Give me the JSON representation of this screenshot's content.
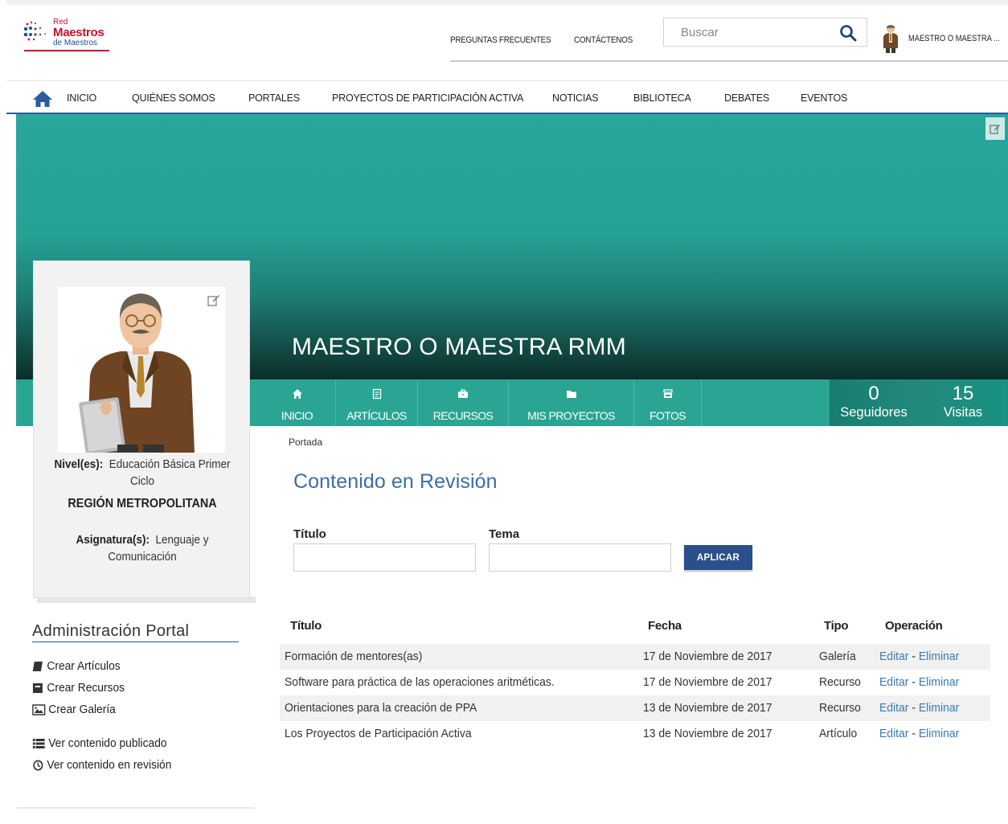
{
  "header": {
    "logo": {
      "line1": "Red",
      "line2": "Maestros",
      "line3": "de Maestros"
    },
    "links": [
      "PREGUNTAS FRECUENTES",
      "CONTÁCTENOS"
    ],
    "search_placeholder": "Buscar",
    "user_name": "MAESTRO O MAESTRA ..."
  },
  "nav": {
    "items": [
      "INICIO",
      "QUIÉNES SOMOS",
      "PORTALES",
      "PROYECTOS DE PARTICIPACIÓN ACTIVA",
      "NOTICIAS",
      "BIBLIOTECA",
      "DEBATES",
      "EVENTOS"
    ]
  },
  "banner": {
    "title": "MAESTRO O MAESTRA RMM"
  },
  "profile_tabs": [
    {
      "label": "INICIO",
      "icon": "home-icon"
    },
    {
      "label": "ARTÍCULOS",
      "icon": "article-icon"
    },
    {
      "label": "RECURSOS",
      "icon": "briefcase-icon"
    },
    {
      "label": "MIS PROYECTOS",
      "icon": "folder-icon"
    },
    {
      "label": "FOTOS",
      "icon": "photos-icon"
    }
  ],
  "stats": {
    "followers": {
      "value": "0",
      "label": "Seguidores"
    },
    "visits": {
      "value": "15",
      "label": "Visitas"
    }
  },
  "profile": {
    "nivel_label": "Nivel(es):",
    "nivel_value": "Educación Básica Primer Ciclo",
    "region": "REGIÓN METROPOLITANA",
    "asignatura_label": "Asignatura(s):",
    "asignatura_value": "Lenguaje y Comunicación"
  },
  "admin": {
    "title": "Administración Portal",
    "links": [
      "Crear Artículos",
      "Crear Recursos",
      "Crear Galería",
      "Ver contenido publicado",
      "Ver contenido en revisión"
    ]
  },
  "content": {
    "breadcrumb": "Portada",
    "title": "Contenido en Revisión",
    "filter_title_label": "Título",
    "filter_topic_label": "Tema",
    "apply_label": "APLICAR",
    "columns": [
      "Título",
      "Fecha",
      "Tipo",
      "Operación"
    ],
    "rows": [
      {
        "title": "Formación de mentores(as)",
        "date": "17 de Noviembre de 2017",
        "type": "Galería",
        "edit": "Editar",
        "sep": " - ",
        "delete": "Eliminar"
      },
      {
        "title": "Software para práctica de las operaciones aritméticas.",
        "date": "17 de Noviembre de 2017",
        "type": "Recurso",
        "edit": "Editar",
        "sep": " - ",
        "delete": "Eliminar"
      },
      {
        "title": "Orientaciones para la creación de PPA",
        "date": "13 de Noviembre de 2017",
        "type": "Recurso",
        "edit": "Editar",
        "sep": " - ",
        "delete": "Eliminar"
      },
      {
        "title": "Los Proyectos de Participación Activa",
        "date": "13 de Noviembre de 2017",
        "type": "Artículo",
        "edit": "Editar",
        "sep": " - ",
        "delete": "Eliminar"
      }
    ]
  },
  "colors": {
    "brand_red": "#c8102e",
    "brand_blue": "#2a4f8a",
    "teal": "#2aa594",
    "link": "#3b78b8"
  }
}
